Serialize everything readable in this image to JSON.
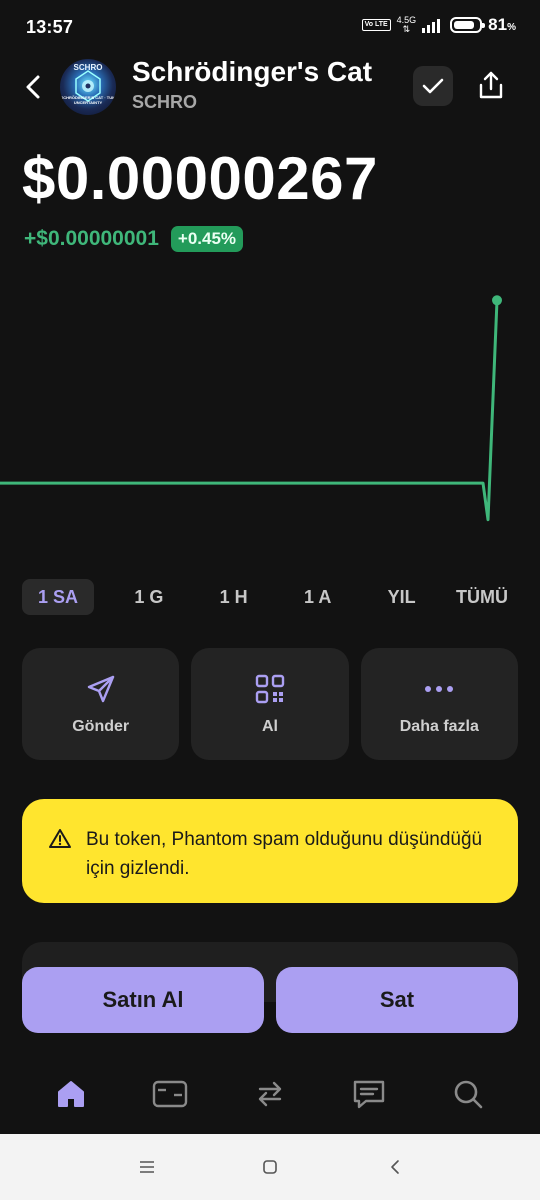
{
  "status_bar": {
    "time": "13:57",
    "volte": "Vo LTE",
    "network": "4.5G",
    "battery_percent": "81",
    "battery_unit": "%",
    "battery_level": 0.81
  },
  "header": {
    "token_name": "Schrödinger's Cat",
    "token_symbol": "SCHRO",
    "logo_text_top": "SCHRO",
    "logo_text_mid": "SCHRÖDINGER'S CAT · TUM UNCERTAINTY"
  },
  "price": {
    "value": "$0.00000267",
    "change_abs": "+$0.00000001",
    "change_pct": "+0.45%"
  },
  "chart_data": {
    "type": "line",
    "color": "#3fb77a",
    "x": [
      0,
      1,
      2,
      3,
      4,
      5,
      6,
      7,
      8,
      9,
      10,
      11,
      12,
      13,
      14,
      15,
      16,
      17,
      18,
      19,
      20
    ],
    "values": [
      2.66e-06,
      2.66e-06,
      2.66e-06,
      2.66e-06,
      2.66e-06,
      2.66e-06,
      2.66e-06,
      2.66e-06,
      2.66e-06,
      2.66e-06,
      2.66e-06,
      2.66e-06,
      2.66e-06,
      2.66e-06,
      2.66e-06,
      2.66e-06,
      2.66e-06,
      2.66e-06,
      2.66e-06,
      2.658e-06,
      2.67e-06
    ],
    "ylim": [
      2.657e-06,
      2.671e-06
    ],
    "grid": false
  },
  "ranges": [
    {
      "label": "1 SA",
      "active": true
    },
    {
      "label": "1 G",
      "active": false
    },
    {
      "label": "1 H",
      "active": false
    },
    {
      "label": "1 A",
      "active": false
    },
    {
      "label": "YIL",
      "active": false
    },
    {
      "label": "TÜMÜ",
      "active": false
    }
  ],
  "actions": {
    "send": {
      "label": "Gönder",
      "icon": "send-icon"
    },
    "receive": {
      "label": "Al",
      "icon": "qr-code-icon"
    },
    "more": {
      "label": "Daha fazla",
      "icon": "more-icon"
    }
  },
  "warning": {
    "text": "Bu token, Phantom spam olduğunu düşündüğü için gizlendi.",
    "icon": "warning-icon"
  },
  "trade": {
    "buy_label": "Satın Al",
    "sell_label": "Sat"
  },
  "tabbar": {
    "items": [
      "home-icon",
      "wallet-icon",
      "swap-icon",
      "chat-icon",
      "search-icon"
    ],
    "active": "home-icon"
  },
  "colors": {
    "accent": "#ab9ff2",
    "positive": "#3fb77a",
    "warning_bg": "#ffe52e",
    "background": "#121212"
  }
}
